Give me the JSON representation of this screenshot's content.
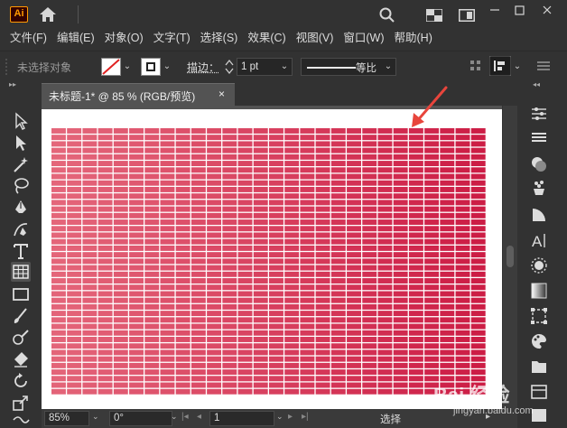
{
  "app": {
    "logo_text": "Ai"
  },
  "menu": [
    "文件(F)",
    "编辑(E)",
    "对象(O)",
    "文字(T)",
    "选择(S)",
    "效果(C)",
    "视图(V)",
    "窗口(W)",
    "帮助(H)"
  ],
  "control_bar": {
    "selection_label": "未选择对象",
    "stroke_label": "描边：",
    "stroke_value": "1 pt",
    "profile_label": "等比"
  },
  "document_tab": {
    "title": "未标题-1* @ 85 % (RGB/预览)",
    "close": "×"
  },
  "grid": {
    "columns": 28,
    "rows": 41,
    "color_left": "#e4667a",
    "color_right": "#c8103c"
  },
  "status_bar": {
    "zoom": "85%",
    "rotation": "0°",
    "artboard": "1",
    "status": "选择"
  },
  "watermark": {
    "text": "Bai 经验",
    "sub": "jingyan.baidu.com"
  },
  "colors": {
    "ui_bg": "#323232",
    "canvas_bg": "#535353",
    "accent_arrow": "#e8453c"
  }
}
